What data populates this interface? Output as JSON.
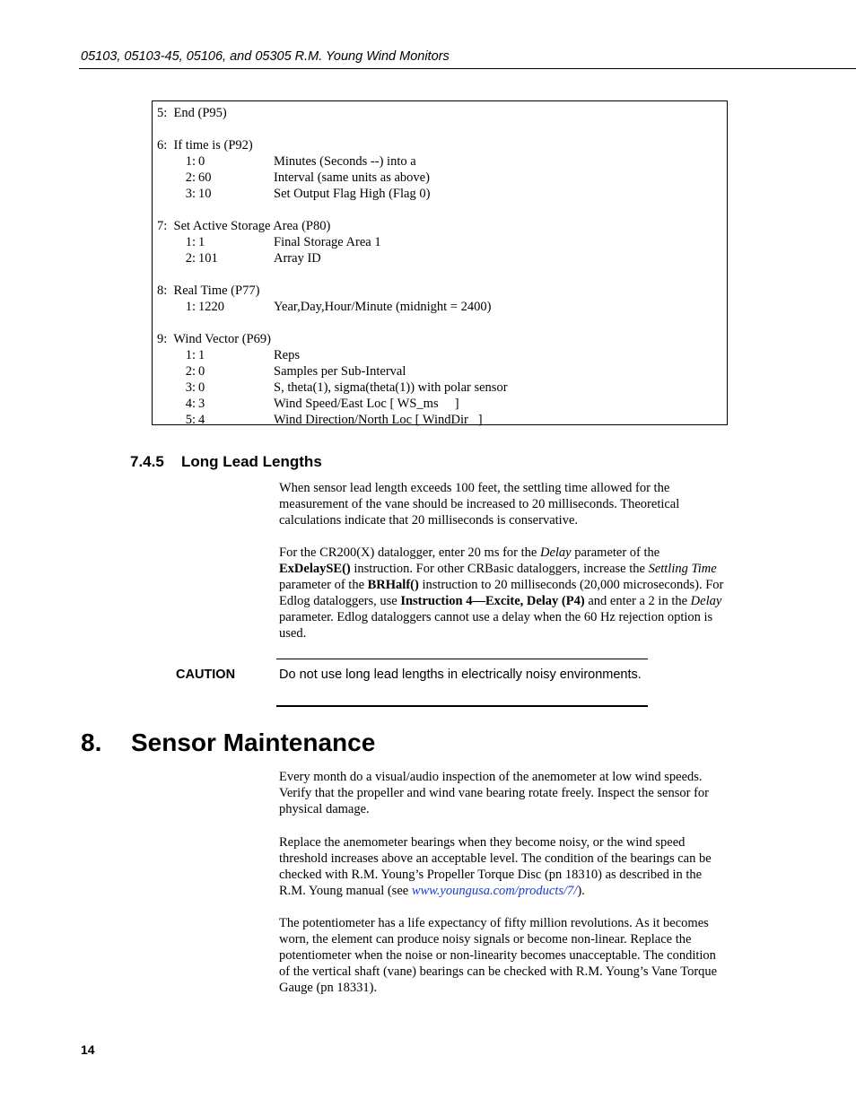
{
  "header": {
    "title": "05103, 05103-45, 05106, and 05305 R.M. Young Wind Monitors"
  },
  "code_listing": [
    {
      "type": "heading",
      "text": "5:  End (P95)"
    },
    {
      "type": "gap"
    },
    {
      "type": "heading",
      "text": "6:  If time is (P92)"
    },
    {
      "type": "param",
      "num": "1:",
      "val": "0",
      "desc": "Minutes (Seconds --) into a"
    },
    {
      "type": "param",
      "num": "2:",
      "val": "60",
      "desc": "Interval (same units as above)"
    },
    {
      "type": "param",
      "num": "3:",
      "val": "10",
      "desc": "Set Output Flag High (Flag 0)"
    },
    {
      "type": "gap"
    },
    {
      "type": "heading",
      "text": "7:  Set Active Storage Area (P80)"
    },
    {
      "type": "param",
      "num": "1:",
      "val": "1",
      "desc": "Final Storage Area 1"
    },
    {
      "type": "param",
      "num": "2:",
      "val": "101",
      "desc": "Array ID"
    },
    {
      "type": "gap"
    },
    {
      "type": "heading",
      "text": "8:  Real Time (P77)"
    },
    {
      "type": "param",
      "num": "1:",
      "val": "1220",
      "desc": "Year,Day,Hour/Minute (midnight = 2400)"
    },
    {
      "type": "gap"
    },
    {
      "type": "heading",
      "text": "9:  Wind Vector (P69)"
    },
    {
      "type": "param",
      "num": "1:",
      "val": "1",
      "desc": "Reps"
    },
    {
      "type": "param",
      "num": "2:",
      "val": "0",
      "desc": "Samples per Sub-Interval"
    },
    {
      "type": "param",
      "num": "3:",
      "val": "0",
      "desc": "S, theta(1), sigma(theta(1)) with polar sensor"
    },
    {
      "type": "param",
      "num": "4:",
      "val": "3",
      "desc": "Wind Speed/East Loc [ WS_ms     ]"
    },
    {
      "type": "param",
      "num": "5:",
      "val": "4",
      "desc": "Wind Direction/North Loc [ WindDir   ]"
    }
  ],
  "section_745": {
    "number": "7.4.5",
    "title": "Long Lead Lengths",
    "para1": "When sensor lead length exceeds 100 feet, the settling time allowed for the measurement of the vane should be increased to 20 milliseconds.  Theoretical calculations indicate that 20 milliseconds is conservative.",
    "para2": {
      "t1": "For the CR200(X) datalogger, enter 20 ms for the ",
      "i1": "Delay",
      "t2": " parameter of the ",
      "b1": "ExDelaySE()",
      "t3": " instruction.  For other CRBasic dataloggers, increase the ",
      "i2": "Settling Time",
      "t4": " parameter of the ",
      "b2": "BRHalf()",
      "t5": " instruction to 20 milliseconds (20,000 microseconds).  For Edlog dataloggers, use ",
      "b3": "Instruction 4—Excite, Delay (P4)",
      "t6": " and enter a 2 in the ",
      "i3": "Delay",
      "t7": " parameter.  Edlog dataloggers cannot use a delay when the 60 Hz rejection option is used."
    },
    "caution_label": "CAUTION",
    "caution_text": "Do not use long lead lengths in electrically noisy environments."
  },
  "section_8": {
    "number": "8.",
    "title": "Sensor Maintenance",
    "para1": "Every month do a visual/audio inspection of the anemometer at low wind speeds.  Verify that the propeller and wind vane bearing rotate freely.  Inspect the sensor for physical damage.",
    "para2_before": "Replace the anemometer bearings when they become noisy, or the wind speed threshold increases above an acceptable level.  The condition of the bearings can be checked with R.M. Young’s Propeller Torque Disc (pn 18310) as described in the R.M. Young manual (see ",
    "para2_link": "www.youngusa.com/products/7/",
    "para2_after": ").",
    "para3": "The potentiometer has a life expectancy of fifty million revolutions.  As it becomes worn, the element can produce noisy signals or become non-linear. Replace the potentiometer when the noise or non-linearity becomes unacceptable.  The condition of the vertical shaft (vane) bearings can be checked with R.M. Young’s Vane Torque Gauge (pn 18331)."
  },
  "footer": {
    "page_number": "14"
  },
  "colors": {
    "link": "#1a3bcc"
  }
}
